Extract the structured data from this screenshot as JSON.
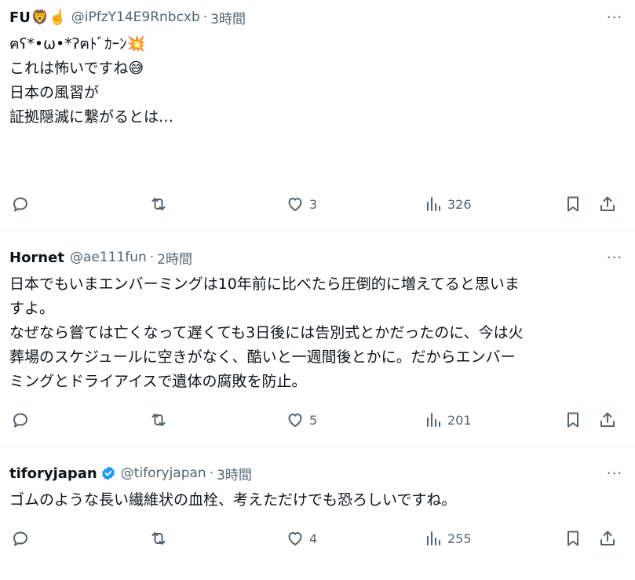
{
  "tweets": [
    {
      "name": "FU",
      "name_emojis": "🦁☝️",
      "handle": "@iPfzY14E9Rnbcxb",
      "dot": "·",
      "time": "3時間",
      "verified": false,
      "lines": [
        "ฅʕ*•ω•*ʔฅﾄﾞｶｰﾝ💥",
        "",
        "これは怖いですね😅",
        "",
        "日本の風習が",
        "証拠隠滅に繋がるとは…"
      ],
      "likes": "3",
      "views": "326"
    },
    {
      "name": "Hornet",
      "name_emojis": "",
      "handle": "@ae111fun",
      "dot": "·",
      "time": "2時間",
      "verified": false,
      "lines": [
        "日本でもいまエンバーミングは10年前に比べたら圧倒的に増えてると思いま",
        "すよ。",
        "なぜなら嘗ては亡くなって遅くても3日後には告別式とかだったのに、今は火",
        "葬場のスケジュールに空きがなく、酷いと一週間後とかに。だからエンバー",
        "ミングとドライアイスで遺体の腐敗を防止。"
      ],
      "likes": "5",
      "views": "201"
    },
    {
      "name": "tiforyjapan",
      "name_emojis": "",
      "handle": "@tiforyjapan",
      "dot": "·",
      "time": "3時間",
      "verified": true,
      "lines": [
        "ゴムのような長い繊維状の血栓、考えただけでも恐ろしいですね。"
      ],
      "likes": "4",
      "views": "255"
    }
  ],
  "more_label": "···",
  "colors": {
    "text": "#0f1419",
    "secondary": "#536471",
    "border": "#eff3f4",
    "verified": "#1d9bf0"
  },
  "icons": {
    "reply": "reply-icon",
    "retweet": "retweet-icon",
    "like": "heart-icon",
    "views": "views-icon",
    "bookmark": "bookmark-icon",
    "share": "share-icon",
    "more": "more-icon",
    "verified": "verified-badge-icon"
  }
}
